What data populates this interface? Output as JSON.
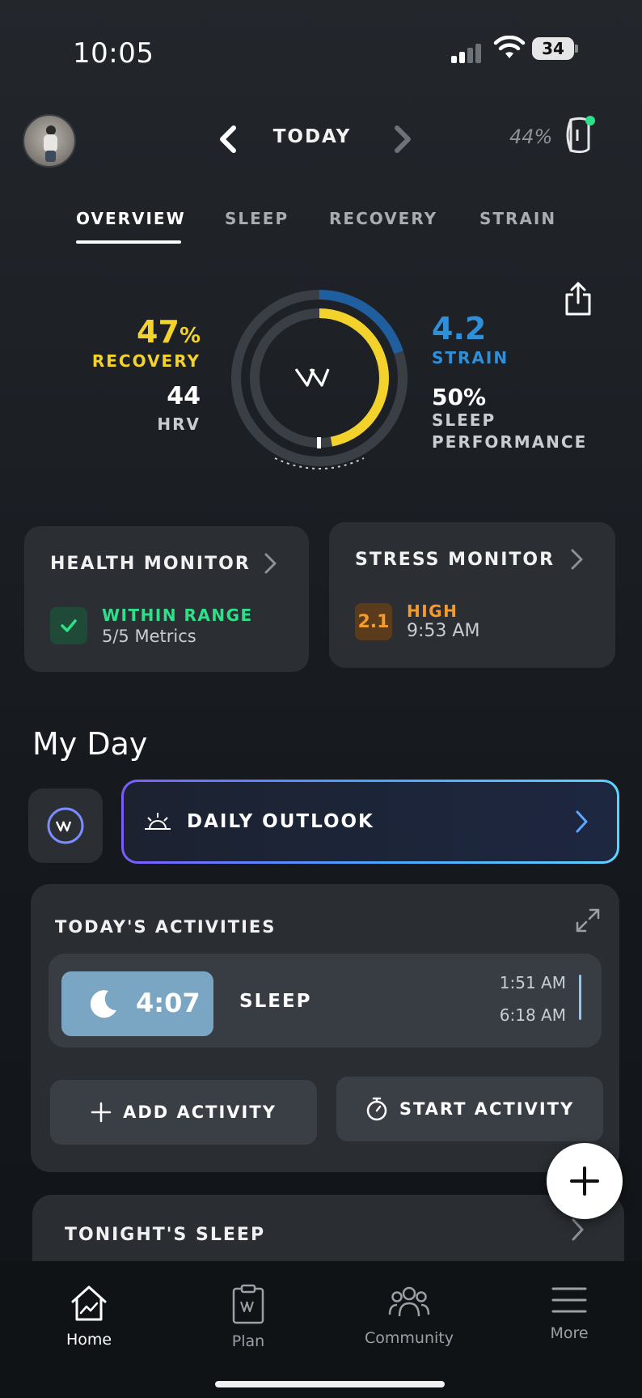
{
  "status_bar": {
    "time": "10:05",
    "battery": "34"
  },
  "header": {
    "date_label": "TODAY",
    "device_battery": "44%"
  },
  "tabs": [
    {
      "label": "OVERVIEW"
    },
    {
      "label": "SLEEP"
    },
    {
      "label": "RECOVERY"
    },
    {
      "label": "STRAIN"
    }
  ],
  "summary": {
    "recovery_value": "47",
    "recovery_unit": "%",
    "recovery_label": "RECOVERY",
    "recovery_fraction": 0.47,
    "hrv_value": "44",
    "hrv_label": "HRV",
    "strain_value": "4.2",
    "strain_label": "STRAIN",
    "strain_fraction": 0.2,
    "sleep_perf_value": "50%",
    "sleep_perf_label_line1": "SLEEP",
    "sleep_perf_label_line2": "PERFORMANCE",
    "colors": {
      "recovery": "#f3d22b",
      "strain": "#2f8fd8"
    }
  },
  "health_monitor": {
    "title": "HEALTH MONITOR",
    "status": "WITHIN RANGE",
    "detail": "5/5 Metrics"
  },
  "stress_monitor": {
    "title": "STRESS MONITOR",
    "score": "2.1",
    "level": "HIGH",
    "time": "9:53 AM"
  },
  "my_day": {
    "heading": "My Day",
    "outlook_label": "DAILY OUTLOOK",
    "activities_title": "TODAY'S ACTIVITIES",
    "activity": {
      "duration": "4:07",
      "name": "SLEEP",
      "start": "1:51 AM",
      "end": "6:18 AM"
    },
    "add_activity": "ADD ACTIVITY",
    "start_activity": "START ACTIVITY",
    "tonight_sleep": "TONIGHT'S SLEEP"
  },
  "nav": [
    {
      "label": "Home",
      "icon": "home-icon"
    },
    {
      "label": "Plan",
      "icon": "clipboard-icon"
    },
    {
      "label": "Community",
      "icon": "people-icon"
    },
    {
      "label": "More",
      "icon": "menu-icon"
    }
  ]
}
